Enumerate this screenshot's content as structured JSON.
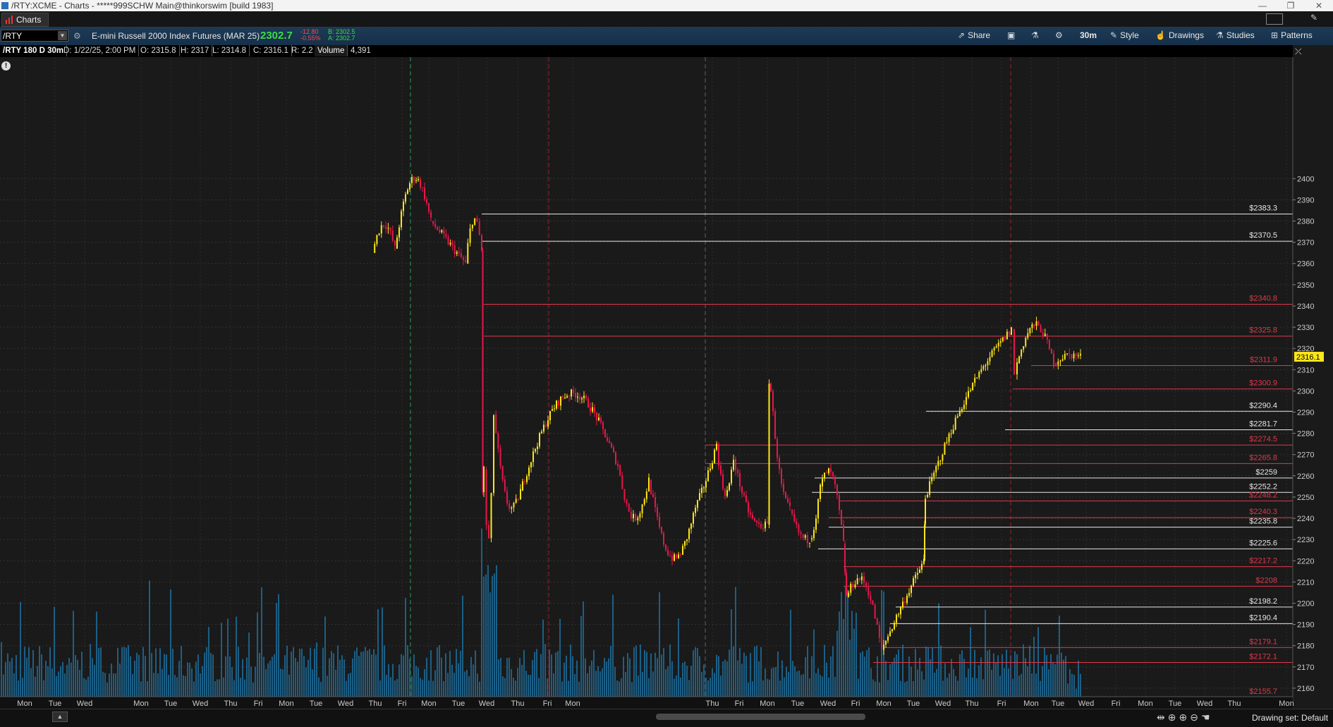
{
  "window": {
    "title": "/RTY:XCME - Charts - *****999SCHW Main@thinkorswim [build 1983]",
    "controls": [
      "—",
      "❐",
      "✕"
    ]
  },
  "tabs": [
    {
      "label": "Charts"
    }
  ],
  "toolbar": {
    "symbol": "/RTY",
    "instrument_name": "E-mini Russell 2000 Index Futures (MAR 25)",
    "last_price": "2302.7",
    "net_change": "-12.80",
    "percent_change": "-0.55%",
    "bid": "B: 2302.5",
    "ask": "A: 2302.7",
    "buttons": {
      "share": "Share",
      "timeframe": "30m",
      "style": "Style",
      "drawings": "Drawings",
      "studies": "Studies",
      "patterns": "Patterns"
    }
  },
  "info_bar": {
    "chart_label": "/RTY 180 D 30m",
    "date": "D: 1/22/25, 2:00 PM",
    "open": "O: 2315.8",
    "high": "H: 2317",
    "low": "L: 2314.8",
    "close": "C: 2316.1",
    "range": "R: 2.2",
    "volume_label": "Volume",
    "volume_value": "4,391"
  },
  "colors": {
    "up_candle": "#ffe61a",
    "down_candle": "#e8164a",
    "volume_bar": "#1c5f86",
    "white_line": "#e6e6e6",
    "red_line": "#e0384a",
    "price_marker": "#ffe61a",
    "background": "#1a1a1a"
  },
  "chart_data": {
    "type": "candlestick",
    "symbol": "/RTY",
    "interval": "30m",
    "ylim": [
      2152,
      2403
    ],
    "y_ticks": [
      2160,
      2170,
      2180,
      2190,
      2200,
      2210,
      2220,
      2230,
      2240,
      2250,
      2260,
      2270,
      2280,
      2290,
      2300,
      2310,
      2320,
      2330,
      2340,
      2350,
      2360,
      2370,
      2380,
      2390,
      2400
    ],
    "current_price": 2316.1,
    "x_day_labels": [
      "Mon",
      "Tue",
      "Wed",
      "Mon",
      "Tue",
      "Wed",
      "Thu",
      "Fri",
      "Mon",
      "Tue",
      "Wed",
      "Thu",
      "Fri",
      "Mon",
      "Tue",
      "Wed",
      "Thu",
      "Fri",
      "Mon",
      "Thu",
      "Fri",
      "Mon",
      "Tue",
      "Wed",
      "Fri",
      "Mon",
      "Tue",
      "Wed",
      "Thu",
      "Fri",
      "Mon",
      "Tue",
      "Wed",
      "Fri",
      "Mon",
      "Tue",
      "Wed",
      "Thu",
      "Mon"
    ],
    "price_path": [
      [
        2400,
        2365
      ],
      [
        2380,
        2367
      ],
      [
        2403,
        2380
      ],
      [
        2370,
        2360
      ],
      [
        2383,
        2366
      ],
      [
        2246,
        2263
      ],
      [
        2225,
        2289
      ],
      [
        2245,
        2253
      ],
      [
        2303,
        2265
      ],
      [
        2238,
        2258
      ],
      [
        2218,
        2245
      ],
      [
        2258,
        2275
      ],
      [
        2250,
        2268
      ],
      [
        2240,
        2237
      ],
      [
        2309,
        2300
      ],
      [
        2257,
        2244
      ],
      [
        2232,
        2230
      ],
      [
        2238,
        2255
      ],
      [
        2262,
        2228
      ],
      [
        2215,
        2203
      ],
      [
        2212,
        2178
      ],
      [
        2200,
        2220
      ],
      [
        2237,
        2250
      ],
      [
        2300,
        2329
      ],
      [
        2307,
        2313
      ],
      [
        2333,
        2313
      ],
      [
        2317,
        2316
      ]
    ],
    "levels": [
      {
        "label": "$2383.3",
        "value": 2383.3,
        "color": "white"
      },
      {
        "label": "$2370.5",
        "value": 2370.5,
        "color": "white"
      },
      {
        "label": "$2340.8",
        "value": 2340.8,
        "color": "red"
      },
      {
        "label": "$2325.8",
        "value": 2325.8,
        "color": "red"
      },
      {
        "label": "$2311.9",
        "value": 2311.9,
        "color": "red"
      },
      {
        "label": "$2300.9",
        "value": 2300.9,
        "color": "red"
      },
      {
        "label": "$2290.4",
        "value": 2290.4,
        "color": "white"
      },
      {
        "label": "$2281.7",
        "value": 2281.7,
        "color": "white"
      },
      {
        "label": "$2274.5",
        "value": 2274.5,
        "color": "red"
      },
      {
        "label": "$2265.8",
        "value": 2265.8,
        "color": "red"
      },
      {
        "label": "$2259",
        "value": 2259,
        "color": "white"
      },
      {
        "label": "$2252.2",
        "value": 2252.2,
        "color": "white"
      },
      {
        "label": "$2248.2",
        "value": 2248.2,
        "color": "red"
      },
      {
        "label": "$2240.3",
        "value": 2240.3,
        "color": "red"
      },
      {
        "label": "$2235.8",
        "value": 2235.8,
        "color": "white"
      },
      {
        "label": "$2225.6",
        "value": 2225.6,
        "color": "white"
      },
      {
        "label": "$2217.2",
        "value": 2217.2,
        "color": "red"
      },
      {
        "label": "$2208",
        "value": 2208,
        "color": "red"
      },
      {
        "label": "$2198.2",
        "value": 2198.2,
        "color": "white"
      },
      {
        "label": "$2190.4",
        "value": 2190.4,
        "color": "white"
      },
      {
        "label": "$2179.1",
        "value": 2179.1,
        "color": "red"
      },
      {
        "label": "$2172.1",
        "value": 2172.1,
        "color": "red"
      },
      {
        "label": "$2155.7",
        "value": 2155.7,
        "color": "red"
      }
    ]
  },
  "bottom_bar": {
    "drawing_set": "Drawing set: Default"
  }
}
